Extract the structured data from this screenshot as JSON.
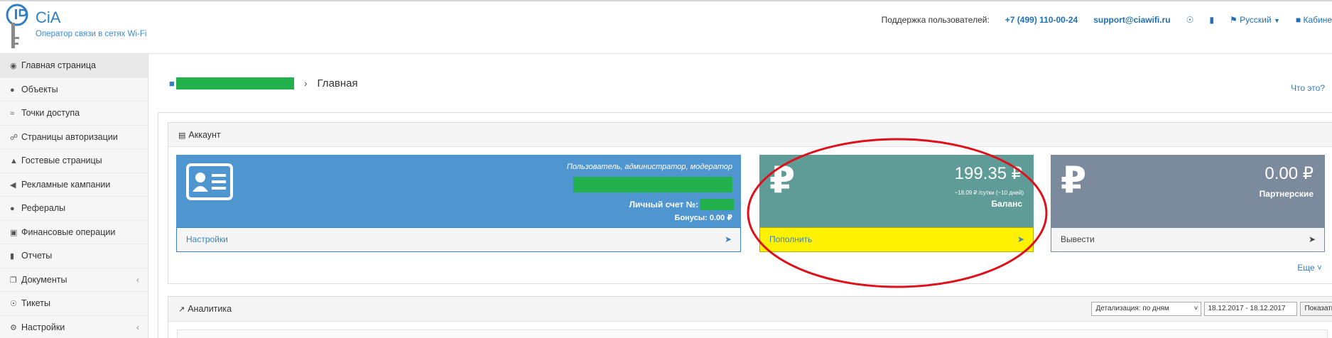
{
  "header": {
    "logo_text": "CiA",
    "logo_subtitle": "Оператор связи в сетях Wi-Fi",
    "support_label": "Поддержка пользователей:",
    "phone": "+7 (499) 110-00-24",
    "email": "support@ciawifi.ru",
    "language": "Русский",
    "cabinet": "Кабине"
  },
  "sidebar": {
    "items": [
      {
        "label": "Главная страница",
        "icon": "dashboard-icon"
      },
      {
        "label": "Объекты",
        "icon": "map-marker-icon"
      },
      {
        "label": "Точки доступа",
        "icon": "wifi-icon"
      },
      {
        "label": "Страницы авторизации",
        "icon": "key-icon"
      },
      {
        "label": "Гостевые страницы",
        "icon": "home-icon"
      },
      {
        "label": "Рекламные кампании",
        "icon": "bullhorn-icon"
      },
      {
        "label": "Рефералы",
        "icon": "users-icon"
      },
      {
        "label": "Финансовые операции",
        "icon": "money-icon"
      },
      {
        "label": "Отчеты",
        "icon": "file-icon"
      },
      {
        "label": "Документы",
        "icon": "documents-icon"
      },
      {
        "label": "Тикеты",
        "icon": "lifebuoy-icon"
      },
      {
        "label": "Настройки",
        "icon": "cogs-icon"
      }
    ]
  },
  "breadcrumb": {
    "title": "Главная",
    "help": "Что это?"
  },
  "account_panel": {
    "title": "Аккаунт",
    "profile_card": {
      "role": "Пользователь, администратор, модератор",
      "account_label": "Личный счет №:",
      "bonus": "Бонусы: 0.00 ₽",
      "footer": "Настройки"
    },
    "balance_card": {
      "amount": "199.35 ₽",
      "per_day": "~18.09 ₽ /сутки (~10 дней)",
      "label": "Баланс",
      "footer": "Пополнить"
    },
    "partner_card": {
      "amount": "0.00 ₽",
      "label": "Партнерские",
      "footer": "Вывести"
    },
    "more": "Еще"
  },
  "analytics_panel": {
    "title": "Аналитика",
    "detail_select": "Детализация: по дням",
    "date_range": "18.12.2017 - 18.12.2017",
    "show_button": "Показать"
  },
  "colors": {
    "profile": "#4f96d1",
    "balance": "#5f9c98",
    "partner": "#7b8a9c",
    "highlight": "#fff200",
    "annotation": "#e0101a"
  }
}
